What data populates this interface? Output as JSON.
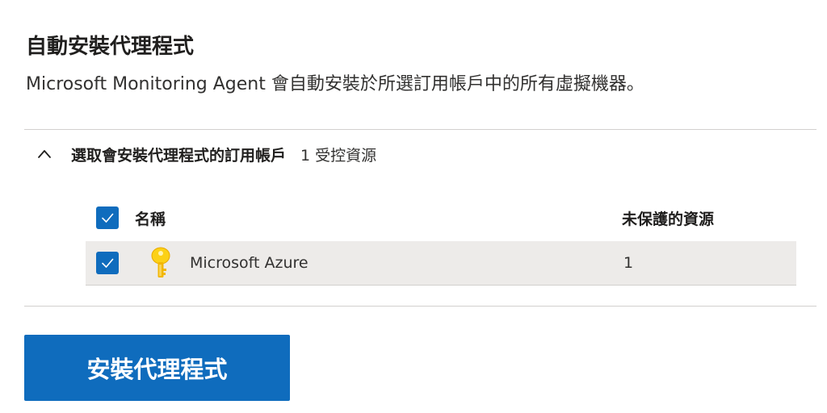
{
  "header": {
    "title": "自動安裝代理程式",
    "description": "Microsoft Monitoring Agent 會自動安裝於所選訂用帳戶中的所有虛擬機器。"
  },
  "section": {
    "title": "選取會安裝代理程式的訂用帳戶",
    "count_label": "1 受控資源",
    "expanded": true,
    "icon": "chevron-up-icon"
  },
  "table": {
    "columns": {
      "name": "名稱",
      "unprotected": "未保護的資源"
    },
    "select_all_checked": true,
    "rows": [
      {
        "checked": true,
        "icon": "key-icon",
        "name": "Microsoft Azure",
        "unprotected": "1"
      }
    ]
  },
  "actions": {
    "install_label": "安裝代理程式"
  },
  "colors": {
    "accent": "#0f6cbd",
    "row_background": "#edebe9",
    "divider": "#d2d0ce",
    "key_icon": "#fcd116"
  }
}
